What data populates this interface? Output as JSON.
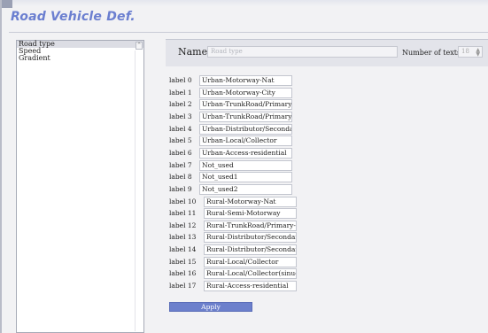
{
  "window": {
    "title": "Road Vehicle Def."
  },
  "sidebar": {
    "items": [
      {
        "label": "Road type"
      },
      {
        "label": "Speed"
      },
      {
        "label": "Gradient"
      }
    ]
  },
  "header": {
    "name_label": "Name",
    "name_value": "Road type",
    "number_label": "Number of texts",
    "number_value": "18"
  },
  "labels": [
    {
      "label": "label 0",
      "value": "Urban-Motorway-Nat"
    },
    {
      "label": "label 1",
      "value": "Urban-Motorway-City"
    },
    {
      "label": "label 2",
      "value": "Urban-TrunkRoad/Primary-"
    },
    {
      "label": "label 3",
      "value": "Urban-TrunkRoad/Primary-"
    },
    {
      "label": "label 4",
      "value": "Urban-Distributor/Secondar"
    },
    {
      "label": "label 5",
      "value": "Urban-Local/Collector"
    },
    {
      "label": "label 6",
      "value": "Urban-Access-residential"
    },
    {
      "label": "label 7",
      "value": "Not_used"
    },
    {
      "label": "label 8",
      "value": "Not_used1"
    },
    {
      "label": "label 9",
      "value": "Not_used2"
    },
    {
      "label": "label 10",
      "value": "Rural-Motorway-Nat"
    },
    {
      "label": "label 11",
      "value": "Rural-Semi-Motorway"
    },
    {
      "label": "label 12",
      "value": "Rural-TrunkRoad/Primary-N"
    },
    {
      "label": "label 13",
      "value": "Rural-Distributor/Secondary"
    },
    {
      "label": "label 14",
      "value": "Rural-Distributor/Secondary"
    },
    {
      "label": "label 15",
      "value": "Rural-Local/Collector"
    },
    {
      "label": "label 16",
      "value": "Rural-Local/Collector(sinuo"
    },
    {
      "label": "label 17",
      "value": "Rural-Access-residential"
    }
  ],
  "actions": {
    "apply_label": "Apply"
  },
  "colors": {
    "accent": "#6c80cc",
    "title": "#6b7fd0"
  }
}
